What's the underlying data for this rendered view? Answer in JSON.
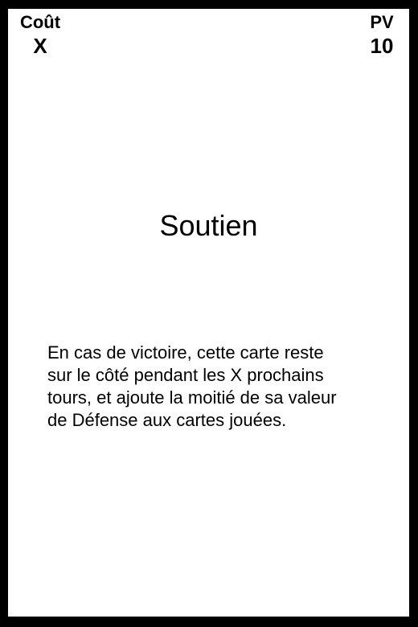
{
  "card": {
    "cost_label": "Coût",
    "cost_value": "X",
    "hp_label": "PV",
    "hp_value": "10",
    "title": "Soutien",
    "text": "En cas de victoire, cette carte reste\nsur le côté pendant les X prochains\ntours, et ajoute la moitié de sa valeur\nde Défense aux cartes jouées."
  },
  "colors": {
    "frame": "#000000",
    "background": "#ffffff",
    "text": "#000000"
  }
}
